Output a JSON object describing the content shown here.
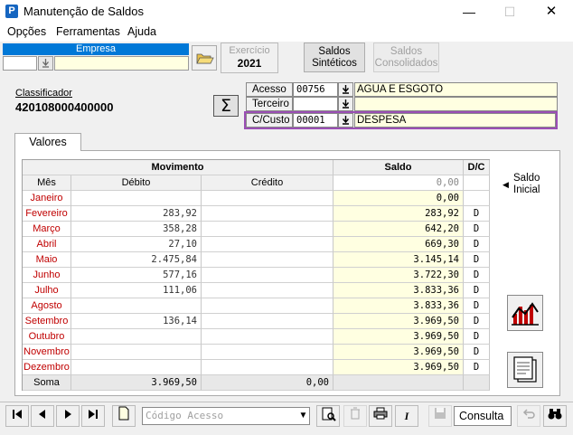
{
  "window": {
    "title": "Manutenção de Saldos",
    "icon_letter": "P",
    "minimize": "—",
    "maximize": "☐",
    "close": "✕"
  },
  "menu": [
    "Opções",
    "Ferramentas",
    "Ajuda"
  ],
  "empresa": {
    "header": "Empresa",
    "code": "",
    "name": ""
  },
  "exercicio": {
    "label": "Exercício",
    "value": "2021"
  },
  "buttons": {
    "saldos_sinteticos": [
      "Saldos",
      "Sintéticos"
    ],
    "saldos_consolidados": [
      "Saldos",
      "Consolidados"
    ]
  },
  "classificador": {
    "label": "Classificador",
    "value": "420108000400000"
  },
  "sigma": "Σ",
  "acesso": {
    "label": "Acesso",
    "code": "00756",
    "desc": "AGUA E ESGOTO"
  },
  "terceiro": {
    "label": "Terceiro",
    "code": "",
    "desc": ""
  },
  "ccusto": {
    "label": "C/Custo",
    "code": "00001",
    "desc": "DESPESA"
  },
  "tab": "Valores",
  "grid": {
    "group_movimento": "Movimento",
    "group_saldo": "Saldo",
    "group_dc": "D/C",
    "col_mes": "Mês",
    "col_debito": "Débito",
    "col_credito": "Crédito",
    "saldo_inicial_value": "0,00",
    "rows": [
      {
        "mes": "Janeiro",
        "debito": "",
        "credito": "",
        "saldo": "0,00",
        "dc": ""
      },
      {
        "mes": "Fevereiro",
        "debito": "283,92",
        "credito": "",
        "saldo": "283,92",
        "dc": "D"
      },
      {
        "mes": "Março",
        "debito": "358,28",
        "credito": "",
        "saldo": "642,20",
        "dc": "D"
      },
      {
        "mes": "Abril",
        "debito": "27,10",
        "credito": "",
        "saldo": "669,30",
        "dc": "D"
      },
      {
        "mes": "Maio",
        "debito": "2.475,84",
        "credito": "",
        "saldo": "3.145,14",
        "dc": "D"
      },
      {
        "mes": "Junho",
        "debito": "577,16",
        "credito": "",
        "saldo": "3.722,30",
        "dc": "D"
      },
      {
        "mes": "Julho",
        "debito": "111,06",
        "credito": "",
        "saldo": "3.833,36",
        "dc": "D"
      },
      {
        "mes": "Agosto",
        "debito": "",
        "credito": "",
        "saldo": "3.833,36",
        "dc": "D"
      },
      {
        "mes": "Setembro",
        "debito": "136,14",
        "credito": "",
        "saldo": "3.969,50",
        "dc": "D"
      },
      {
        "mes": "Outubro",
        "debito": "",
        "credito": "",
        "saldo": "3.969,50",
        "dc": "D"
      },
      {
        "mes": "Novembro",
        "debito": "",
        "credito": "",
        "saldo": "3.969,50",
        "dc": "D"
      },
      {
        "mes": "Dezembro",
        "debito": "",
        "credito": "",
        "saldo": "3.969,50",
        "dc": "D"
      }
    ],
    "soma": {
      "label": "Soma",
      "debito": "3.969,50",
      "credito": "0,00"
    }
  },
  "saldo_inicial": [
    "Saldo",
    "Inicial"
  ],
  "toolbar": {
    "codigo_placeholder": "Código Acesso",
    "mode": "Consulta"
  },
  "colors": {
    "mes_text": "#c00000",
    "saldo_bg": "#ffffe1",
    "highlight_border": "#9b4fb5",
    "selection": "#0078d7"
  }
}
